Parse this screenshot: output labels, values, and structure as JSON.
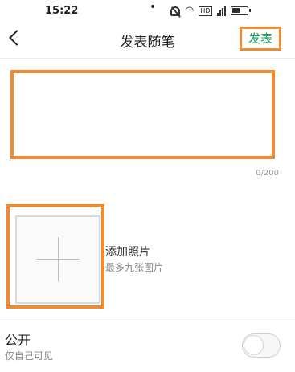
{
  "status_bar": {
    "time": "15:22",
    "dot": "•",
    "icons": [
      "mute-icon",
      "wifi-icon",
      "hd-icon",
      "signal-icon",
      "battery-icon"
    ],
    "hd_label": "HD"
  },
  "header": {
    "title": "发表随笔",
    "publish_label": "发表"
  },
  "editor": {
    "value": "",
    "counter": "0/200"
  },
  "photos": {
    "label": "添加照片",
    "sublabel": "最多九张图片"
  },
  "privacy": {
    "label": "公开",
    "sublabel": "仅自己可见",
    "toggle_on": false
  },
  "colors": {
    "accent_green": "#17a05d",
    "highlight_orange": "#ef8b32"
  }
}
